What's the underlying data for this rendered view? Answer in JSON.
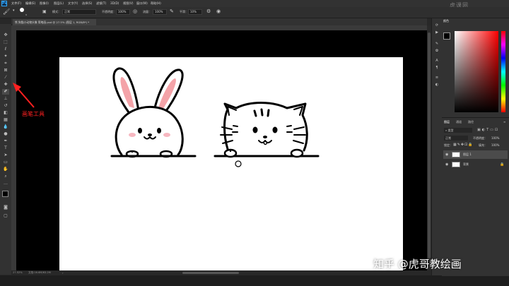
{
  "menubar": {
    "items": [
      "文件(F)",
      "编辑(E)",
      "图像(I)",
      "图层(L)",
      "文字(Y)",
      "选择(S)",
      "滤镜(T)",
      "3D(D)",
      "视图(V)",
      "窗口(W)",
      "帮助(H)"
    ]
  },
  "options": {
    "mode_label": "模式：",
    "mode_value": "正常",
    "opacity_label": "不透明度：",
    "opacity_value": "100%",
    "flow_label": "流量：",
    "flow_value": "100%",
    "smooth_label": "平滑：",
    "smooth_value": "10%",
    "brush_size": "9"
  },
  "document": {
    "tab_title": "熊 狗猫小动物头像 简笔画.psd @ 27.5% (图层 1, RGB/8*) *",
    "zoom": "27.52%",
    "doc_info": "文档:16.6M/63.2M"
  },
  "annotation": {
    "label": "画笔工具",
    "color": "#ff2020"
  },
  "color_panel": {
    "tab": "颜色"
  },
  "layers_panel": {
    "tabs": [
      "图层",
      "通道",
      "路径"
    ],
    "kind_label": "类型",
    "blend_mode": "正常",
    "opacity_label": "不透明度：",
    "opacity_value": "100%",
    "lock_label": "锁定：",
    "fill_label": "填充：",
    "fill_value": "100%",
    "layers": [
      {
        "name": "图层 1",
        "selected": true
      },
      {
        "name": "背景",
        "selected": false
      }
    ]
  },
  "watermark": {
    "text": "知乎 @虎哥教绘画"
  },
  "brand": {
    "text": "虎课网"
  },
  "colors": {
    "accent": "#31a8ff",
    "panel": "#323232",
    "workspace": "#000000",
    "canvas": "#ffffff",
    "bunny_ear": "#f4a3a8",
    "blush": "#f7b7c0"
  }
}
